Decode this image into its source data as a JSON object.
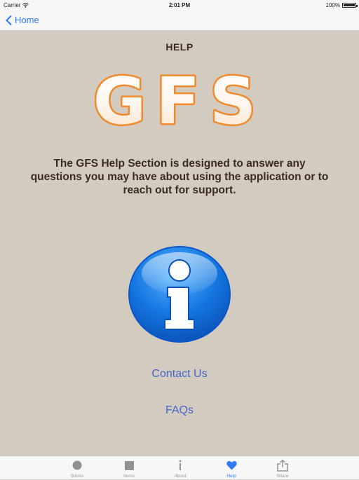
{
  "status_bar": {
    "carrier": "Carrier",
    "time": "2:01 PM",
    "battery": "100%"
  },
  "nav": {
    "back_label": "Home"
  },
  "header": {
    "title": "HELP",
    "logo_text": "GFS"
  },
  "main": {
    "description": "The GFS Help Section is designed to answer any questions you may have about using the application or to reach out for support.",
    "contact_label": "Contact Us",
    "faqs_label": "FAQs"
  },
  "tabs": [
    {
      "label": "Stores",
      "icon": "circle-icon",
      "active": false
    },
    {
      "label": "Items",
      "icon": "square-icon",
      "active": false
    },
    {
      "label": "About",
      "icon": "info-icon",
      "active": false
    },
    {
      "label": "Help",
      "icon": "heart-icon",
      "active": true
    },
    {
      "label": "Share",
      "icon": "share-icon",
      "active": false
    }
  ],
  "colors": {
    "background": "#d4cbc0",
    "link": "#4466cc",
    "accent": "#2f7cf6",
    "logo_orange": "#f08a2c",
    "text_brown": "#3c2b1f"
  }
}
